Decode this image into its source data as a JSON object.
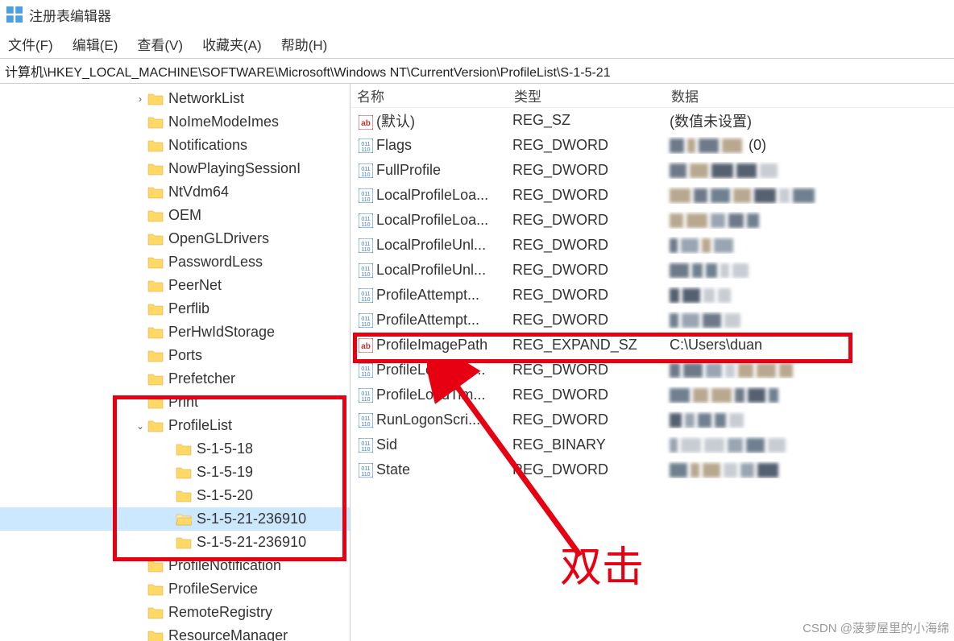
{
  "window": {
    "title": "注册表编辑器"
  },
  "menu": {
    "file": "文件(F)",
    "edit": "编辑(E)",
    "view": "查看(V)",
    "favorites": "收藏夹(A)",
    "help": "帮助(H)"
  },
  "address": "计算机\\HKEY_LOCAL_MACHINE\\SOFTWARE\\Microsoft\\Windows NT\\CurrentVersion\\ProfileList\\S-1-5-21",
  "list_header": {
    "name": "名称",
    "type": "类型",
    "data": "数据"
  },
  "tree": [
    {
      "expander": ">",
      "label": "NetworkList",
      "indent": 165
    },
    {
      "expander": "",
      "label": "NoImeModeImes",
      "indent": 165
    },
    {
      "expander": "",
      "label": "Notifications",
      "indent": 165
    },
    {
      "expander": "",
      "label": "NowPlayingSessionI",
      "indent": 165
    },
    {
      "expander": "",
      "label": "NtVdm64",
      "indent": 165
    },
    {
      "expander": "",
      "label": "OEM",
      "indent": 165
    },
    {
      "expander": "",
      "label": "OpenGLDrivers",
      "indent": 165
    },
    {
      "expander": "",
      "label": "PasswordLess",
      "indent": 165
    },
    {
      "expander": "",
      "label": "PeerNet",
      "indent": 165
    },
    {
      "expander": "",
      "label": "Perflib",
      "indent": 165
    },
    {
      "expander": "",
      "label": "PerHwIdStorage",
      "indent": 165
    },
    {
      "expander": "",
      "label": "Ports",
      "indent": 165
    },
    {
      "expander": "",
      "label": "Prefetcher",
      "indent": 165
    },
    {
      "expander": "",
      "label": "Print",
      "indent": 165
    },
    {
      "expander": "v",
      "label": "ProfileList",
      "indent": 165
    },
    {
      "expander": "",
      "label": "S-1-5-18",
      "indent": 200
    },
    {
      "expander": "",
      "label": "S-1-5-19",
      "indent": 200
    },
    {
      "expander": "",
      "label": "S-1-5-20",
      "indent": 200
    },
    {
      "expander": "",
      "label": "S-1-5-21-236910",
      "indent": 200,
      "selected": true
    },
    {
      "expander": "",
      "label": "S-1-5-21-236910",
      "indent": 200
    },
    {
      "expander": "",
      "label": "ProfileNotification",
      "indent": 165
    },
    {
      "expander": "",
      "label": "ProfileService",
      "indent": 165
    },
    {
      "expander": "",
      "label": "RemoteRegistry",
      "indent": 165
    },
    {
      "expander": "",
      "label": "ResourceManager",
      "indent": 165
    }
  ],
  "rows": [
    {
      "iconType": "sz",
      "name": "(默认)",
      "type": "REG_SZ",
      "data": "(数值未设置)",
      "blur": false
    },
    {
      "iconType": "bin",
      "name": "Flags",
      "type": "REG_DWORD",
      "data": "(0)",
      "blur": true
    },
    {
      "iconType": "bin",
      "name": "FullProfile",
      "type": "REG_DWORD",
      "data": "",
      "blur": true
    },
    {
      "iconType": "bin",
      "name": "LocalProfileLoa...",
      "type": "REG_DWORD",
      "data": "",
      "blur": true
    },
    {
      "iconType": "bin",
      "name": "LocalProfileLoa...",
      "type": "REG_DWORD",
      "data": "",
      "blur": true
    },
    {
      "iconType": "bin",
      "name": "LocalProfileUnl...",
      "type": "REG_DWORD",
      "data": "",
      "blur": true
    },
    {
      "iconType": "bin",
      "name": "LocalProfileUnl...",
      "type": "REG_DWORD",
      "data": "",
      "blur": true
    },
    {
      "iconType": "bin",
      "name": "ProfileAttempt...",
      "type": "REG_DWORD",
      "data": "",
      "blur": true
    },
    {
      "iconType": "bin",
      "name": "ProfileAttempt...",
      "type": "REG_DWORD",
      "data": "",
      "blur": true
    },
    {
      "iconType": "sz",
      "name": "ProfileImagePath",
      "type": "REG_EXPAND_SZ",
      "data": "C:\\Users\\duan",
      "blur": false
    },
    {
      "iconType": "bin",
      "name": "ProfileLoadTim...",
      "type": "REG_DWORD",
      "data": "",
      "blur": true
    },
    {
      "iconType": "bin",
      "name": "ProfileLoadTim...",
      "type": "REG_DWORD",
      "data": "",
      "blur": true
    },
    {
      "iconType": "bin",
      "name": "RunLogonScri...",
      "type": "REG_DWORD",
      "data": "",
      "blur": true
    },
    {
      "iconType": "bin",
      "name": "Sid",
      "type": "REG_BINARY",
      "data": "",
      "blur": true
    },
    {
      "iconType": "bin",
      "name": "State",
      "type": "REG_DWORD",
      "data": "",
      "blur": true
    }
  ],
  "annotation": {
    "text": "双击"
  },
  "watermark": "CSDN @菠萝屋里的小海绵"
}
